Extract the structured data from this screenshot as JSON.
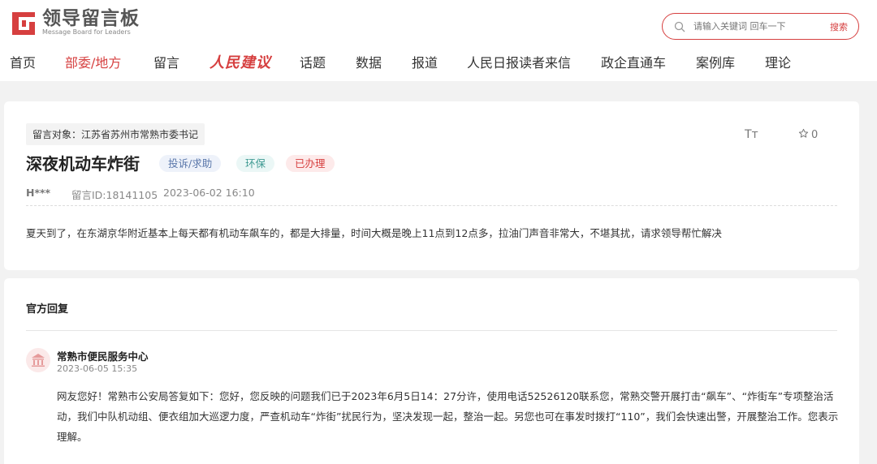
{
  "brand": {
    "logo_cn": "领导留言板",
    "logo_en": "Message Board for Leaders",
    "accent": "#d63f3f"
  },
  "search": {
    "placeholder": "请输入关键词 回车一下",
    "button_label": "搜索"
  },
  "nav": {
    "items": [
      {
        "label": "首页",
        "active": false
      },
      {
        "label": "部委/地方",
        "active": true
      },
      {
        "label": "留言",
        "active": false
      },
      {
        "label": "人民建议",
        "active": false,
        "brand": true
      },
      {
        "label": "话题",
        "active": false
      },
      {
        "label": "数据",
        "active": false
      },
      {
        "label": "报道",
        "active": false
      },
      {
        "label": "人民日报读者来信",
        "active": false
      },
      {
        "label": "政企直通车",
        "active": false
      },
      {
        "label": "案例库",
        "active": false
      },
      {
        "label": "理论",
        "active": false
      }
    ]
  },
  "message": {
    "target": "留言对象：江苏省苏州市常熟市委书记",
    "font_size_label": "Tт",
    "favorite_count": "0",
    "title": "深夜机动车炸街",
    "tags": [
      {
        "label": "投诉/求助",
        "color": "#5a77aa"
      },
      {
        "label": "环保",
        "color": "#3f9a92"
      },
      {
        "label": "已办理",
        "color": "#d63f3f"
      }
    ],
    "user": "H***",
    "message_id": "留言ID:18141105",
    "datetime": "2023-06-02 16:10",
    "content": "夏天到了，在东湖京华附近基本上每天都有机动车飙车的，都是大排量，时间大概是晚上11点到12点多，拉油门声音非常大，不堪其扰，请求领导帮忙解决"
  },
  "reply": {
    "heading": "官方回复",
    "org_name": "常熟市便民服务中心",
    "datetime": "2023-06-05 15:35",
    "content": "网友您好！常熟市公安局答复如下：您好，您反映的问题我们已于2023年6月5日14：27分许，使用电话52526120联系您，常熟交警开展打击“飙车”、“炸街车”专项整治活动，我们中队机动组、便衣组加大巡逻力度，严查机动车“炸街”扰民行为，坚决发现一起，整治一起。另您也可在事发时拨打“110”，我们会快速出警，开展整治工作。您表示理解。"
  }
}
